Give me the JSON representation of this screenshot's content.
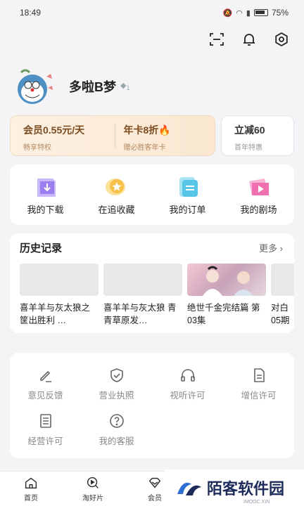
{
  "status_bar": {
    "time": "18:49",
    "battery": "75%"
  },
  "profile": {
    "username": "多啦B梦",
    "level": "1"
  },
  "vip": {
    "member_title": "会员0.55元/天",
    "member_sub": "畅享特权",
    "annual_title": "年卡8折🔥",
    "annual_sub": "赠必胜客年卡",
    "coupon_title": "立减60",
    "coupon_sub": "首年特惠"
  },
  "shortcuts": [
    {
      "label": "我的下载",
      "icon": "download-icon",
      "color": "#9b7ff0"
    },
    {
      "label": "在追收藏",
      "icon": "star-icon",
      "color": "#f5c148"
    },
    {
      "label": "我的订单",
      "icon": "order-icon",
      "color": "#57c6e6"
    },
    {
      "label": "我的剧场",
      "icon": "theater-icon",
      "color": "#ef6fb0"
    }
  ],
  "history": {
    "title": "历史记录",
    "more": "更多 ›",
    "items": [
      {
        "title": "喜羊羊与灰太狼之筐出胜利 …"
      },
      {
        "title": "喜羊羊与灰太狼 青青草原发…"
      },
      {
        "title": "绝世千金完结篇 第03集"
      },
      {
        "title": "对白 05期"
      }
    ]
  },
  "services": [
    {
      "label": "意见反馈",
      "icon": "feedback-icon"
    },
    {
      "label": "营业执照",
      "icon": "shield-check-icon"
    },
    {
      "label": "视听许可",
      "icon": "headphones-icon"
    },
    {
      "label": "增信许可",
      "icon": "document-icon"
    },
    {
      "label": "经营许可",
      "icon": "list-doc-icon"
    },
    {
      "label": "我的客服",
      "icon": "help-icon"
    }
  ],
  "nav": [
    {
      "label": "首页",
      "icon": "home-icon"
    },
    {
      "label": "淘好片",
      "icon": "search-play-icon"
    },
    {
      "label": "会员",
      "icon": "vip-diamond-icon"
    }
  ],
  "watermark": {
    "text": "陌客软件园",
    "sub": "IMOOC.XIN"
  }
}
